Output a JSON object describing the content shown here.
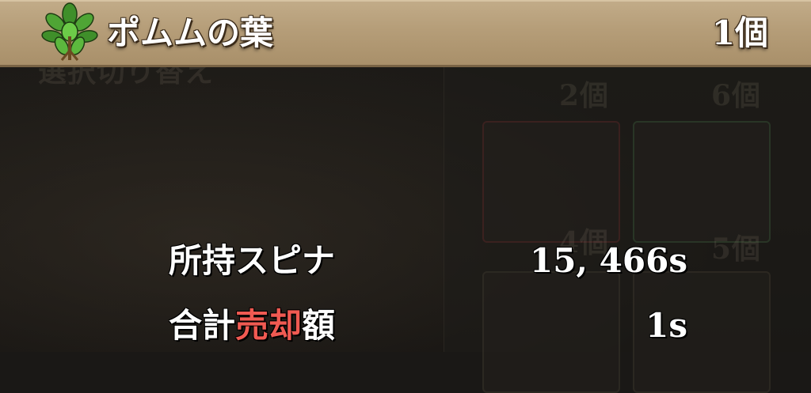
{
  "item": {
    "name": "ポムムの葉",
    "count": "1個",
    "icon": "leaf-plant-icon"
  },
  "background": {
    "ghost_texts": [
      "選択切り替え",
      "2個",
      "6個",
      "4個",
      "5個"
    ]
  },
  "info": {
    "spina_label": "所持スピナ",
    "spina_value": "15, 466s",
    "total_label_pre": "合計",
    "total_label_accent": "売却",
    "total_label_post": "額",
    "total_value": "1s"
  },
  "colors": {
    "header": "#b59d78",
    "accent": "#f05a52",
    "background": "#1a1816"
  }
}
